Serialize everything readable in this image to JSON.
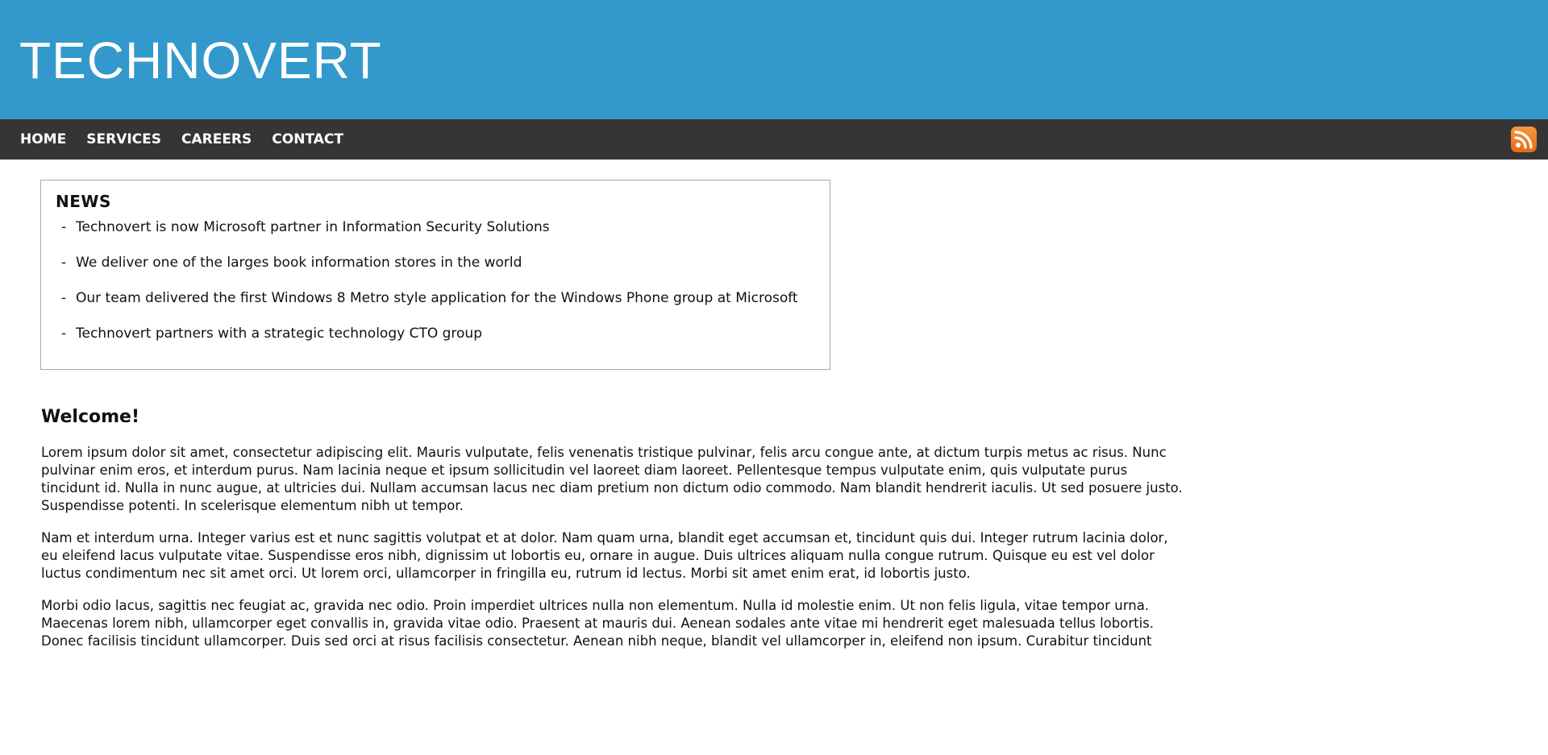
{
  "header": {
    "logo_text": "TECHNOVERT",
    "background_color": "#3399cc"
  },
  "nav": {
    "background_color": "#353535",
    "items": [
      {
        "label": "HOME"
      },
      {
        "label": "SERVICES"
      },
      {
        "label": "CAREERS"
      },
      {
        "label": "CONTACT"
      }
    ],
    "rss_icon": "rss-feed-icon"
  },
  "news": {
    "title": "NEWS",
    "items": [
      {
        "text": "Technovert is now Microsoft partner in Information Security Solutions"
      },
      {
        "text": "We deliver one of the larges book information stores in the world"
      },
      {
        "text": "Our team delivered the first Windows 8 Metro style application for the Windows Phone group at Microsoft"
      },
      {
        "text": "Technovert partners with a strategic technology CTO group"
      }
    ]
  },
  "main": {
    "heading": "Welcome!",
    "paragraphs": [
      {
        "text": "Lorem ipsum dolor sit amet, consectetur adipiscing elit. Mauris vulputate, felis venenatis tristique pulvinar, felis arcu congue ante, at dictum turpis metus ac risus. Nunc pulvinar enim eros, et interdum purus. Nam lacinia neque et ipsum sollicitudin vel laoreet diam laoreet. Pellentesque tempus vulputate enim, quis vulputate purus tincidunt id. Nulla in nunc augue, at ultricies dui. Nullam accumsan lacus nec diam pretium non dictum odio commodo. Nam blandit hendrerit iaculis. Ut sed posuere justo. Suspendisse potenti. In scelerisque elementum nibh ut tempor."
      },
      {
        "text": "Nam et interdum urna. Integer varius est et nunc sagittis volutpat et at dolor. Nam quam urna, blandit eget accumsan et, tincidunt quis dui. Integer rutrum lacinia dolor, eu eleifend lacus vulputate vitae. Suspendisse eros nibh, dignissim ut lobortis eu, ornare in augue. Duis ultrices aliquam nulla congue rutrum. Quisque eu est vel dolor luctus condimentum nec sit amet orci. Ut lorem orci, ullamcorper in fringilla eu, rutrum id lectus. Morbi sit amet enim erat, id lobortis justo."
      },
      {
        "text": "Morbi odio lacus, sagittis nec feugiat ac, gravida nec odio. Proin imperdiet ultrices nulla non elementum. Nulla id molestie enim. Ut non felis ligula, vitae tempor urna. Maecenas lorem nibh, ullamcorper eget convallis in, gravida vitae odio. Praesent at mauris dui. Aenean sodales ante vitae mi hendrerit eget malesuada tellus lobortis. Donec facilisis tincidunt ullamcorper. Duis sed orci at risus facilisis consectetur. Aenean nibh neque, blandit vel ullamcorper in, eleifend non ipsum. Curabitur tincidunt"
      }
    ]
  }
}
